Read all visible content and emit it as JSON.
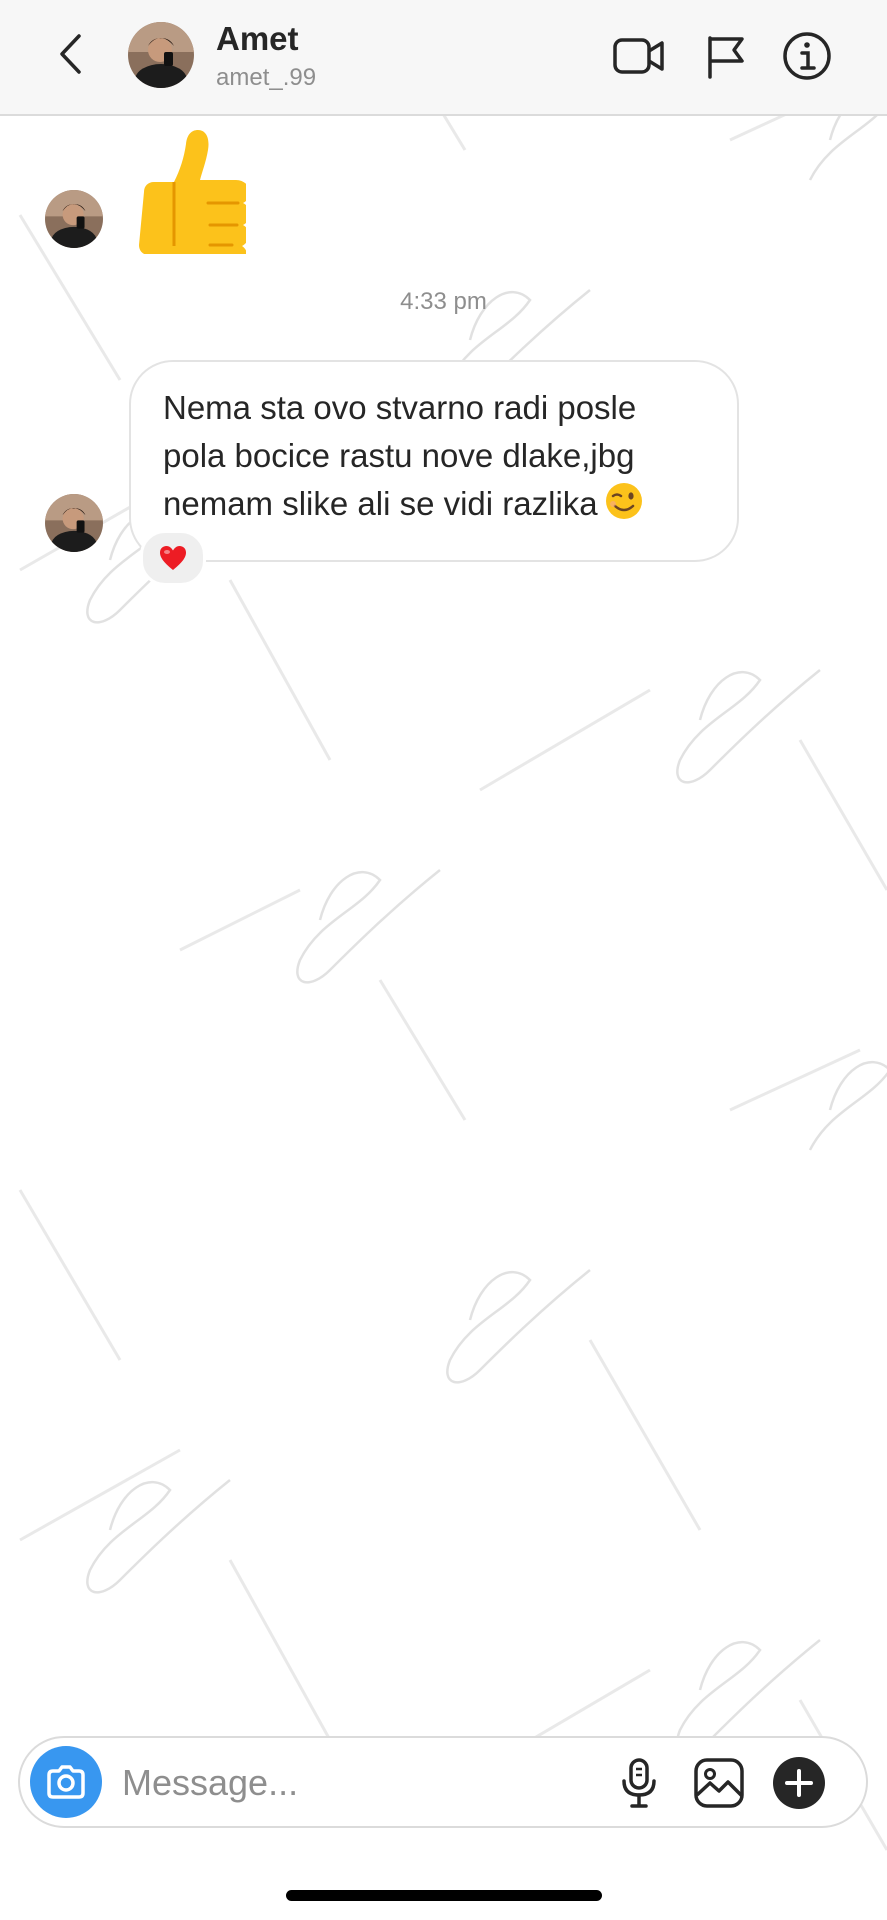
{
  "header": {
    "back_icon": "chevron-left-icon",
    "avatar_icon": "profile-photo",
    "name": "Amet",
    "username": "amet_.99",
    "actions": [
      "video-call-icon",
      "flag-icon",
      "info-icon"
    ]
  },
  "messages": [
    {
      "type": "emoji",
      "sender": "Amet",
      "content": "👍",
      "icon": "thumbs-up-emoji"
    },
    {
      "type": "timestamp",
      "text": "4:33 pm"
    },
    {
      "type": "text",
      "sender": "Amet",
      "lines": [
        "Nema sta ovo stvarno radi posle",
        "pola bocice rastu nove dlake,jbg",
        "nemam slike ali se vidi razlika"
      ],
      "trailing_emoji": "😉",
      "reaction": "❤️"
    }
  ],
  "composer": {
    "placeholder": "Message...",
    "value": "",
    "icons": [
      "camera-icon",
      "microphone-icon",
      "gallery-icon",
      "plus-icon"
    ]
  },
  "colors": {
    "accent": "#3897f0",
    "header_bg": "#f7f7f7",
    "secondary_text": "#8e8e8e",
    "border": "#dbdbdb",
    "heart": "#ed1c24",
    "thumb": "#fcc21b"
  }
}
